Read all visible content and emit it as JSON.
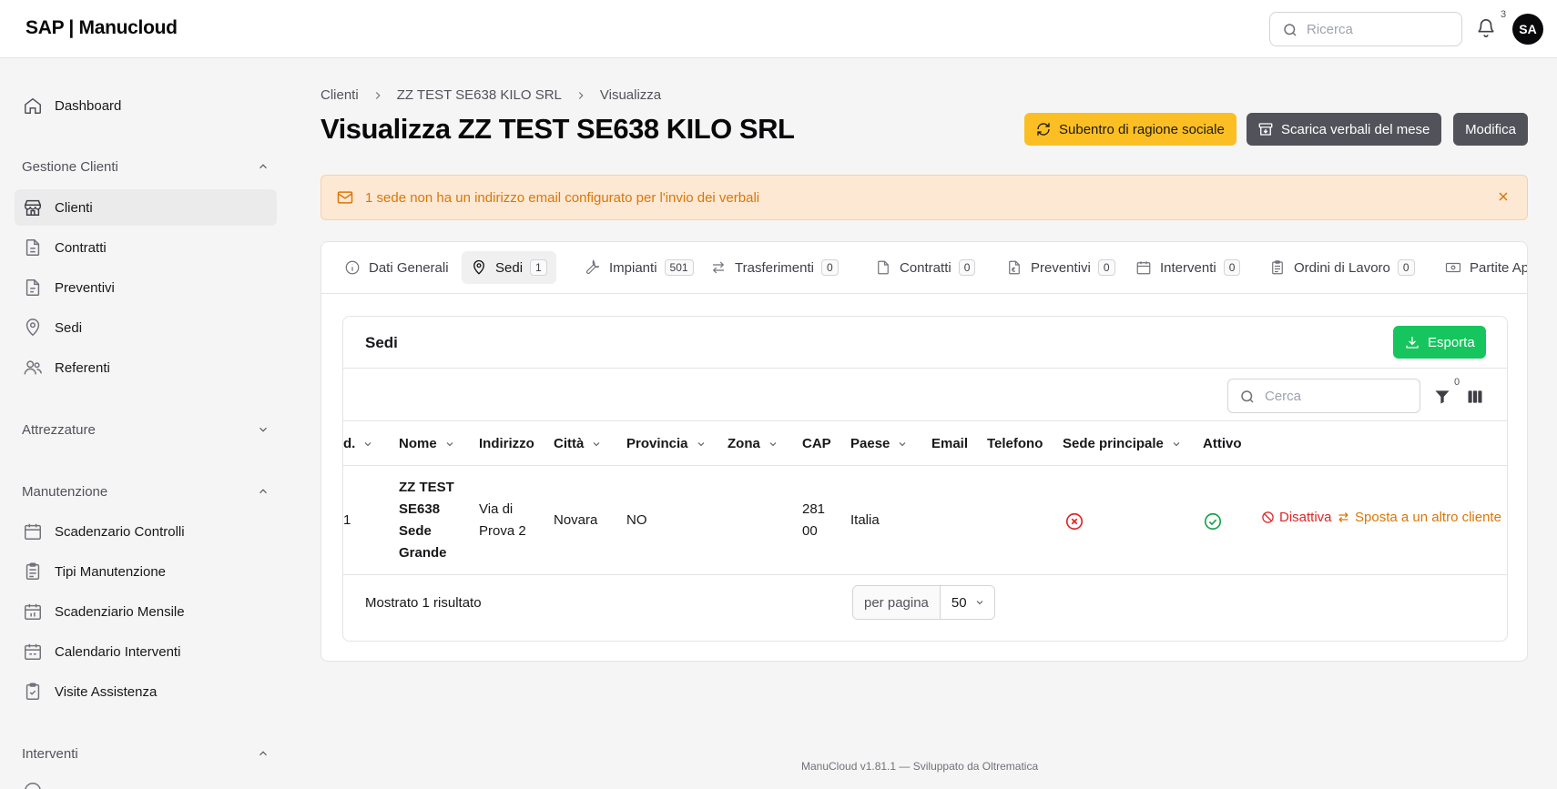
{
  "app": {
    "logo": "SAP | Manucloud"
  },
  "topbar": {
    "search_placeholder": "Ricerca",
    "notifications_count": "3",
    "avatar_initials": "SA"
  },
  "sidebar": {
    "dashboard": "Dashboard",
    "groups": [
      {
        "label": "Gestione Clienti",
        "expanded": true,
        "items": [
          "Clienti",
          "Contratti",
          "Preventivi",
          "Sedi",
          "Referenti"
        ]
      },
      {
        "label": "Attrezzature",
        "expanded": false,
        "items": []
      },
      {
        "label": "Manutenzione",
        "expanded": true,
        "items": [
          "Scadenzario Controlli",
          "Tipi Manutenzione",
          "Scadenziario Mensile",
          "Calendario Interventi",
          "Visite Assistenza"
        ]
      },
      {
        "label": "Interventi",
        "expanded": true,
        "items": []
      }
    ],
    "active_item": "Clienti"
  },
  "breadcrumb": [
    "Clienti",
    "ZZ TEST SE638 KILO SRL",
    "Visualizza"
  ],
  "page_title": "Visualizza ZZ TEST SE638 KILO SRL",
  "actions": {
    "subentro": "Subentro di ragione sociale",
    "scarica": "Scarica verbali del mese",
    "modifica": "Modifica"
  },
  "alert": {
    "text": "1 sede non ha un indirizzo email configurato per l'invio dei verbali"
  },
  "tabs": [
    {
      "label": "Dati Generali",
      "count": null
    },
    {
      "label": "Sedi",
      "count": "1"
    },
    {
      "label": "Impianti",
      "count": "501"
    },
    {
      "label": "Trasferimenti",
      "count": "0"
    },
    {
      "label": "Contratti",
      "count": "0"
    },
    {
      "label": "Preventivi",
      "count": "0"
    },
    {
      "label": "Interventi",
      "count": "0"
    },
    {
      "label": "Ordini di Lavoro",
      "count": "0"
    },
    {
      "label": "Partite Ape",
      "count": null
    }
  ],
  "active_tab": "Sedi",
  "section": {
    "title": "Sedi",
    "export_label": "Esporta",
    "search_placeholder": "Cerca",
    "filter_count": "0"
  },
  "table": {
    "columns": [
      "d.",
      "Nome",
      "Indirizzo",
      "Città",
      "Provincia",
      "Zona",
      "CAP",
      "Paese",
      "Email",
      "Telefono",
      "Sede principale",
      "Attivo"
    ],
    "rows": [
      {
        "id": "1",
        "nome": [
          "ZZ TEST",
          "SE638",
          "Sede",
          "Grande"
        ],
        "indirizzo": [
          "Via di",
          "Prova 2"
        ],
        "citta": "Novara",
        "provincia": "NO",
        "zona": "",
        "cap": [
          "281",
          "00"
        ],
        "paese": "Italia",
        "email": "",
        "telefono": "",
        "sede_principale": false,
        "attivo": true,
        "action_disattiva": "Disattiva",
        "action_sposta": "Sposta a un altro cliente"
      }
    ]
  },
  "pagination": {
    "result_text": "Mostrato 1 risultato",
    "per_page_label": "per pagina",
    "per_page_value": "50"
  },
  "footer": {
    "text": "ManuCloud v1.81.1 — Sviluppato da Oltrematica"
  },
  "colors": {
    "yellow": "#fbbf24",
    "green": "#16c55e",
    "dark_button": "#52525b",
    "alert_bg": "#fde8d4",
    "alert_text": "#d97706",
    "red": "#dc2626"
  }
}
